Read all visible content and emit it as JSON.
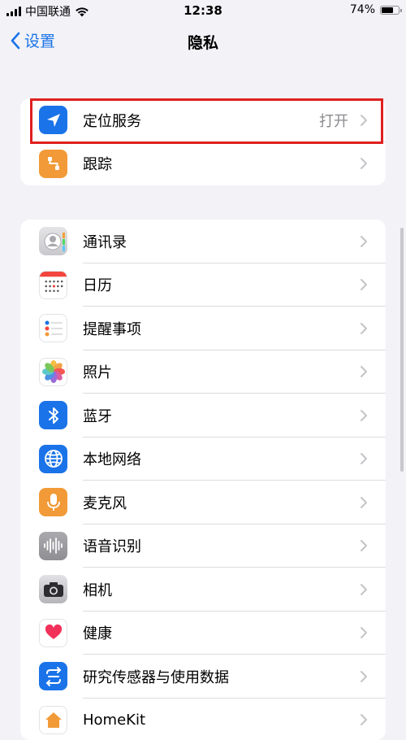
{
  "statusbar": {
    "carrier": "中国联通",
    "time": "12:38",
    "battery": "74%",
    "battery_level": 0.74
  },
  "navbar": {
    "back_label": "设置",
    "title": "隐私"
  },
  "group1": [
    {
      "label": "定位服务",
      "value": "打开",
      "icon": "location-arrow-icon"
    },
    {
      "label": "跟踪",
      "value": "",
      "icon": "tracking-icon"
    }
  ],
  "group2": [
    {
      "label": "通讯录",
      "icon": "contacts-icon"
    },
    {
      "label": "日历",
      "icon": "calendar-icon"
    },
    {
      "label": "提醒事项",
      "icon": "reminders-icon"
    },
    {
      "label": "照片",
      "icon": "photos-icon"
    },
    {
      "label": "蓝牙",
      "icon": "bluetooth-icon"
    },
    {
      "label": "本地网络",
      "icon": "globe-icon"
    },
    {
      "label": "麦克风",
      "icon": "microphone-icon"
    },
    {
      "label": "语音识别",
      "icon": "speech-waveform-icon"
    },
    {
      "label": "相机",
      "icon": "camera-icon"
    },
    {
      "label": "健康",
      "icon": "heart-icon"
    },
    {
      "label": "研究传感器与使用数据",
      "icon": "research-icon"
    },
    {
      "label": "HomeKit",
      "icon": "home-icon"
    }
  ],
  "colors": {
    "accent": "#1a73e8",
    "highlight": "#e02020",
    "background": "#f2f2f7"
  }
}
